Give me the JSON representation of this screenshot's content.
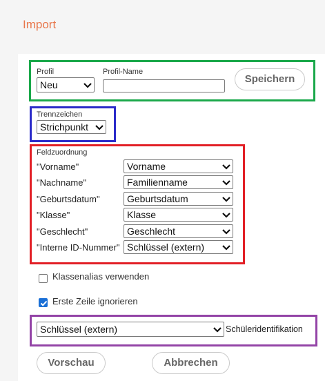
{
  "page": {
    "title": "Import"
  },
  "profile": {
    "label": "Profil",
    "selected": "Neu",
    "name_label": "Profil-Name",
    "name_value": "",
    "save_label": "Speichern"
  },
  "separator": {
    "label": "Trennzeichen",
    "selected": "Strichpunkt"
  },
  "field_mapping": {
    "label": "Feldzuordnung",
    "rows": [
      {
        "field": "\"Vorname\"",
        "selected": "Vorname"
      },
      {
        "field": "\"Nachname\"",
        "selected": "Familienname"
      },
      {
        "field": "\"Geburtsdatum\"",
        "selected": "Geburtsdatum"
      },
      {
        "field": "\"Klasse\"",
        "selected": "Klasse"
      },
      {
        "field": "\"Geschlecht\"",
        "selected": "Geschlecht"
      },
      {
        "field": "\"Interne ID-Nummer\"",
        "selected": "Schlüssel (extern)"
      }
    ]
  },
  "options": {
    "class_alias": {
      "label": "Klassenalias verwenden",
      "checked": false
    },
    "skip_first_row": {
      "label": "Erste Zeile ignorieren",
      "checked": true
    }
  },
  "student_id": {
    "selected": "Schlüssel (extern)",
    "label": "Schüleridentifikation"
  },
  "actions": {
    "preview_label": "Vorschau",
    "cancel_label": "Abbrechen"
  },
  "colors": {
    "title": "#e8774b",
    "frame_profile": "#1aa84a",
    "frame_separator": "#2b2bc9",
    "frame_mapping": "#e21f26",
    "frame_identification": "#9343a6",
    "checkbox_checked": "#1a6fd6"
  },
  "icons": {
    "dropdown": "chevron-down-icon",
    "check": "checkmark-icon"
  }
}
